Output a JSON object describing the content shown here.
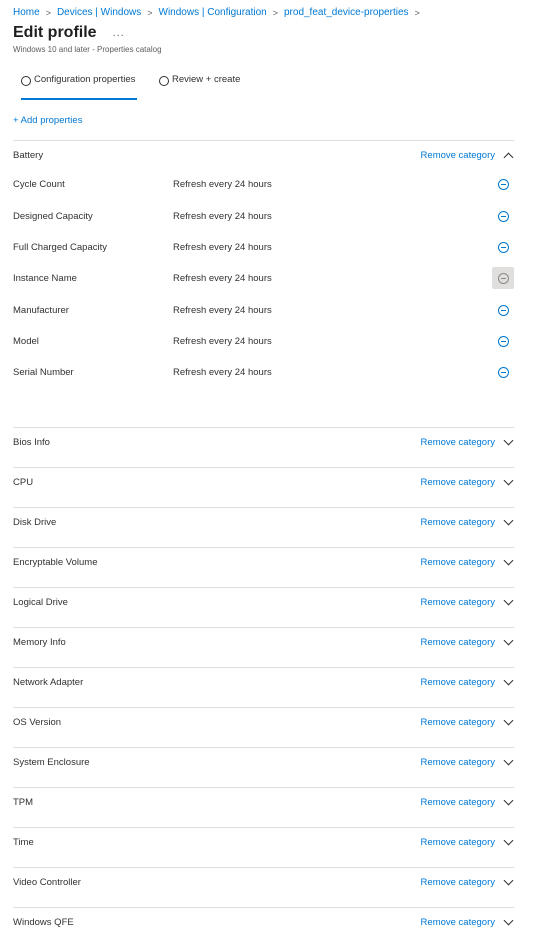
{
  "breadcrumb": {
    "items": [
      "Home",
      "Devices | Windows",
      "Windows | Configuration",
      "prod_feat_device-properties"
    ],
    "separator": ">"
  },
  "header": {
    "title": "Edit profile",
    "more": "...",
    "subtitle": "Windows 10 and later - Properties catalog"
  },
  "tabs": [
    {
      "label": "Configuration properties",
      "active": true
    },
    {
      "label": "Review + create",
      "active": false
    }
  ],
  "add_properties": "+ Add properties",
  "remove_label": "Remove category",
  "expanded_category": {
    "name": "Battery",
    "expanded": true,
    "properties": [
      {
        "name": "Cycle Count",
        "value": "Refresh every 24 hours"
      },
      {
        "name": "Designed Capacity",
        "value": "Refresh every 24 hours"
      },
      {
        "name": "Full Charged Capacity",
        "value": "Refresh every 24 hours"
      },
      {
        "name": "Instance Name",
        "value": "Refresh every 24 hours",
        "hovered": true
      },
      {
        "name": "Manufacturer",
        "value": "Refresh every 24 hours"
      },
      {
        "name": "Model",
        "value": "Refresh every 24 hours"
      },
      {
        "name": "Serial Number",
        "value": "Refresh every 24 hours"
      }
    ]
  },
  "collapsed_categories": [
    "Bios Info",
    "CPU",
    "Disk Drive",
    "Encryptable Volume",
    "Logical Drive",
    "Memory Info",
    "Network Adapter",
    "OS Version",
    "System Enclosure",
    "TPM",
    "Time",
    "Video Controller",
    "Windows QFE"
  ],
  "colors": {
    "accent": "#0078d4",
    "text": "#323130",
    "divider": "#e1dfdd"
  }
}
